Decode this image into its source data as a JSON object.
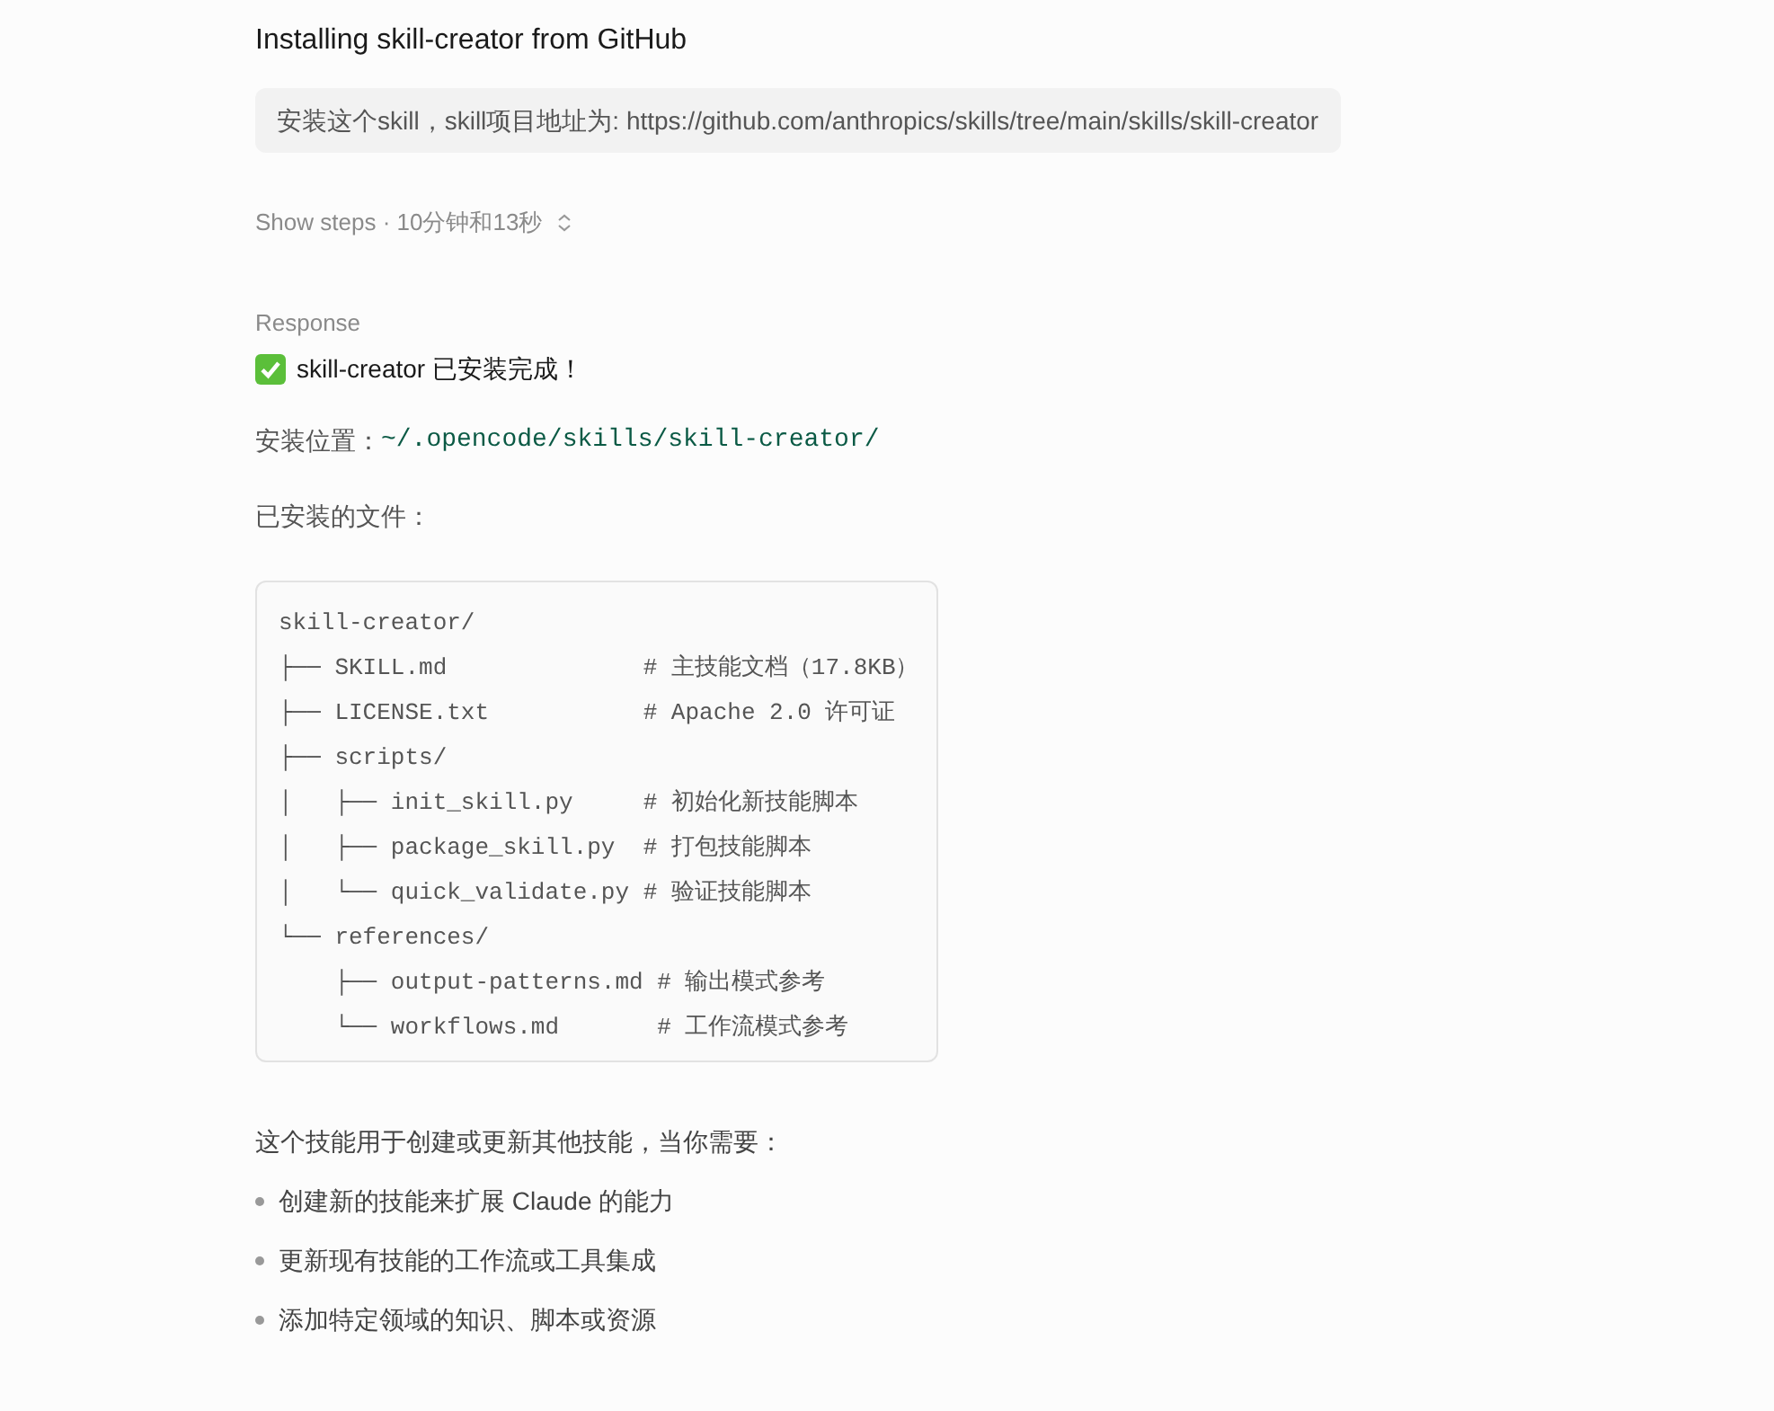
{
  "title": "Installing skill-creator from GitHub",
  "prompt": "安装这个skill，skill项目地址为: https://github.com/anthropics/skills/tree/main/skills/skill-creator",
  "steps_toggle": {
    "label": "Show steps · 10分钟和13秒",
    "expanded": false
  },
  "response_label": "Response",
  "response": {
    "headline": "skill-creator 已安装完成！",
    "location_label": "安装位置：",
    "location_path": "~/.opencode/skills/skill-creator/",
    "files_label": "已安装的文件：",
    "code_lines": [
      "skill-creator/",
      "├── SKILL.md              # 主技能文档（17.8KB）",
      "├── LICENSE.txt           # Apache 2.0 许可证",
      "├── scripts/",
      "│   ├── init_skill.py     # 初始化新技能脚本",
      "│   ├── package_skill.py  # 打包技能脚本",
      "│   └── quick_validate.py # 验证技能脚本",
      "└── references/",
      "    ├── output-patterns.md # 输出模式参考",
      "    └── workflows.md       # 工作流模式参考"
    ],
    "summary": "这个技能用于创建或更新其他技能，当你需要：",
    "bullets": [
      "创建新的技能来扩展 Claude 的能力",
      "更新现有技能的工作流或工具集成",
      "添加特定领域的知识、脚本或资源"
    ]
  }
}
